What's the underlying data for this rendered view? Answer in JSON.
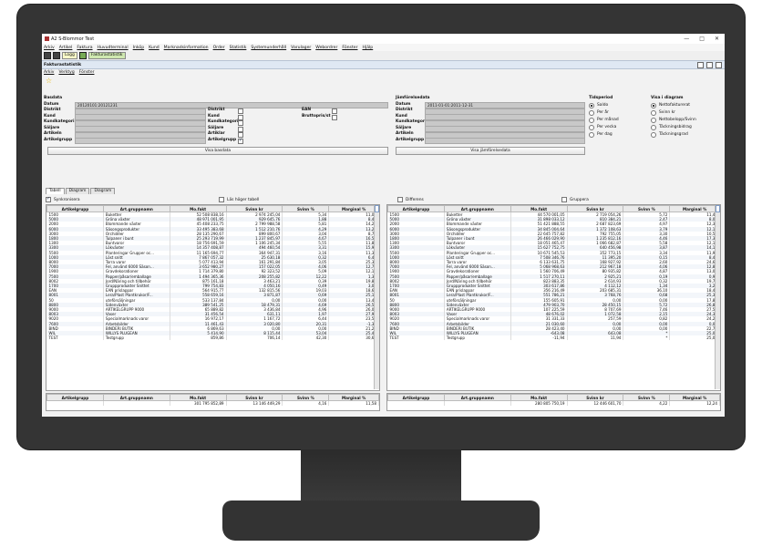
{
  "window": {
    "title": "A2 S-Blommor Test",
    "min": "—",
    "max": "□",
    "close": "✕"
  },
  "menu": [
    "Arkiv",
    "Artikel",
    "Faktura",
    "Huvudterminal",
    "Inköp",
    "Kund",
    "Marknadsinformation",
    "Order",
    "Statistik",
    "Systemunderhåll",
    "Varulager",
    "Webordrer",
    "Fönster",
    "Hjälp"
  ],
  "toolbar": {
    "logg": "Logg",
    "fakturastatistik": "Fakturastatistik"
  },
  "inner": {
    "title": "Fakturastatistik",
    "menu": [
      "Arkiv",
      "Verktyg",
      "Fönster"
    ]
  },
  "basdata": {
    "heading": "Basdata",
    "datum_label": "Datum",
    "datum": "20120101:20121231",
    "labels": [
      "Distrikt",
      "Kund",
      "Kundkategori",
      "Säljare",
      "Artikeln",
      "Artikelgrupp"
    ],
    "right_labels": [
      "Distrikt",
      "Kund",
      "Kundkategori",
      "Säljare",
      "Artiklar",
      "Artikelgrupp"
    ],
    "ean": "EAN",
    "brutto": "Bruttopris/st",
    "show": "Visa basdata"
  },
  "jamfor": {
    "heading": "Jämförelsedata",
    "datum_label": "Datum",
    "datum": "2011-01-01:2011-12-31",
    "labels": [
      "Distrikt",
      "Kund",
      "Kundkategori",
      "Säljare",
      "Artikeln",
      "Artikelgrupp"
    ],
    "show": "Visa jämförelsedata"
  },
  "tidsperiod": {
    "heading": "Tidsperiod",
    "options": [
      "Saldo",
      "Per år",
      "Per månad",
      "Per vecka",
      "Per dag"
    ],
    "selected": 0
  },
  "visa": {
    "heading": "Visa i diagram",
    "options": [
      "Nettofakturerat",
      "Svinn kr",
      "Nettobelopp/Svinn",
      "Täckningsbidrag",
      "Täckningsgrad"
    ],
    "selected": 0
  },
  "tabs": [
    "Tabell",
    "Diagram",
    "Diagram"
  ],
  "options": {
    "synkronisera": "Synkronisera",
    "las_hoger": "Läs höger tabell",
    "differens": "Differens",
    "gruppera": "Gruppera"
  },
  "columns": [
    "Artikelgrupp",
    "Art.gruppnamn",
    "Mo.fakt",
    "Svinn kr",
    "Svinn %",
    "Marginal %"
  ],
  "left_rows": [
    [
      "1500",
      "Buketter",
      "52 508 838,16",
      "2 974 245,04",
      "5,34",
      "11,03"
    ],
    [
      "5000",
      "Gröna växter",
      "48 971 001,95",
      "929 645,76",
      "1,88",
      "8,40"
    ],
    [
      "2000",
      "Blommande växter",
      "45 408 233,75",
      "2 799 988,58",
      "5,81",
      "14,23"
    ],
    [
      "6000",
      "Säsongsprodukter",
      "33 495 383,68",
      "1 512 210,76",
      "4,29",
      "13,26"
    ],
    [
      "3000",
      "Orchidéer",
      "28 135 290,67",
      "899 800,67",
      "3,04",
      "8,72"
    ],
    [
      "1800",
      "Tulpaner i bunt",
      "25 293 719,99",
      "1 237 845,97",
      "4,67",
      "16,56"
    ],
    [
      "1300",
      "Buntvaror",
      "18 756 691,59",
      "1 106 245,34",
      "5,55",
      "11,86"
    ],
    [
      "3300",
      "Lökväxter",
      "14 357 408,87",
      "494 460,54",
      "3,31",
      "15,98"
    ],
    [
      "5500",
      "Planteringar Grupper oc...",
      "11 165 694,77",
      "364 947,31",
      "3,16",
      "11,36"
    ],
    [
      "1000",
      "Löst snitt",
      "7 867 057,32",
      "25 630,18",
      "0,32",
      "6,47"
    ],
    [
      "8000",
      "Torra varor",
      "5 077 413,94",
      "161 291,84",
      "3,05",
      "25,36"
    ],
    [
      "7000",
      "Fel, använd 6000 Säson...",
      "3 652 980,27",
      "157 022,05",
      "4,06",
      "12,79"
    ],
    [
      "1900",
      "Gravdekorationer",
      "1 714 379,80",
      "92 323,52",
      "5,09",
      "12,17"
    ],
    [
      "7500",
      "Papper/påsar/emballage",
      "1 494 365,36",
      "208 255,82",
      "12,22",
      "1,30"
    ],
    [
      "8002",
      "Jord/Näring och tillbehör",
      "875 161,18",
      "3 463,21",
      "0,39",
      "19,88"
    ],
    [
      "1700",
      "Gruppprodukter Snittet",
      "799 754,83",
      "4 050,16",
      "0,49",
      "3,02"
    ],
    [
      "EAN",
      "EAN prislappar",
      "564 915,77",
      "132 815,56",
      "19,03",
      "18,66"
    ],
    [
      "8001",
      "Lera/Plast Plantkrukor/F...",
      "558 659,16",
      "3 871,87",
      "0,69",
      "25,12"
    ],
    [
      "50",
      "uteförsäljningar",
      "533 137,84",
      "0,00",
      "0,00",
      "13,41"
    ],
    [
      "8800",
      "Sidenväxter",
      "389 541,25",
      "18 479,31",
      "4,69",
      "26,57"
    ],
    [
      "9000",
      "ARTIKELGRUPP 9000",
      "65 889,82",
      "3 436,84",
      "4,96",
      "26,08"
    ],
    [
      "8003",
      "Vaser",
      "31 456,54",
      "631,11",
      "1,97",
      "27,97"
    ],
    [
      "9020",
      "Specialmarknads varor",
      "16 972,17",
      "1 167,72",
      "6,44",
      "23,54"
    ],
    [
      "7600",
      "Arbetsbilder",
      "11 461,43",
      "3 020,80",
      "20,31",
      "-1,36"
    ],
    [
      "BIND",
      "BINDERI BUTIK",
      "6 869,63",
      "0,00",
      "0,00",
      "21,23"
    ],
    [
      "WIL",
      "WILLYS PLUGEAN",
      "5 414,90",
      "8 115,44",
      "53,04",
      "25,48"
    ],
    [
      "TEST",
      "Testgrupp",
      "859,86",
      "706,14",
      "42,30",
      "30,61"
    ]
  ],
  "right_rows": [
    [
      "1500",
      "Buketter",
      "44 570 001,05",
      "2 719 054,26",
      "5,72",
      "11,42"
    ],
    [
      "5000",
      "Gröna växter",
      "31 898 033,12",
      "810 384,21",
      "2,47",
      "8,09"
    ],
    [
      "2000",
      "Blommande växter",
      "51 421 888,55",
      "2 687 823,69",
      "4,97",
      "12,31"
    ],
    [
      "6000",
      "Säsongsprodukter",
      "34 845 004,64",
      "1 372 108,63",
      "3,79",
      "12,19"
    ],
    [
      "3000",
      "Orchidéer",
      "22 645 757,82",
      "792 755,05",
      "3,30",
      "10,55"
    ],
    [
      "1800",
      "Tulpaner i bunt",
      "26 466 029,90",
      "1 235 812,16",
      "4,46",
      "17,39"
    ],
    [
      "1300",
      "Buntvaror",
      "18 051 465,47",
      "1 066 682,87",
      "5,58",
      "12,19"
    ],
    [
      "3300",
      "Lökväxter",
      "15 627 752,75",
      "640 456,98",
      "3,87",
      "14,16"
    ],
    [
      "5500",
      "Planteringar Grupper oc...",
      "10 671 545,53",
      "352 773,15",
      "3,34",
      "11,95"
    ],
    [
      "1000",
      "Löst snitt",
      "7 508 346,76",
      "11 395,20",
      "0,15",
      "8,40"
    ],
    [
      "8000",
      "Torra varor",
      "6 133 631,75",
      "168 927,92",
      "2,60",
      "24,65"
    ],
    [
      "7000",
      "Fel, använd 6000 Säson...",
      "5 068 968,63",
      "212 967,18",
      "4,06",
      "12,83"
    ],
    [
      "1900",
      "Gravdekorationer",
      "1 560 706,49",
      "80 935,82",
      "4,87",
      "13,03"
    ],
    [
      "7500",
      "Papper/påsar/emballage",
      "1 517 270,11",
      "2 925,21",
      "0,19",
      "0,92"
    ],
    [
      "8002",
      "Jord/Näring och tillbehör",
      "823 883,35",
      "2 614,93",
      "0,32",
      "19,75"
    ],
    [
      "1700",
      "Gruppprodukter Snittet",
      "303 617,86",
      "4 112,12",
      "1,34",
      "3,28"
    ],
    [
      "EAN",
      "EAN prislappar",
      "356 216,49",
      "203 685,31",
      "36,10",
      "18,48"
    ],
    [
      "8001",
      "Lera/Plast Plantkrukor/F...",
      "551 786,21",
      "3 768,76",
      "0,68",
      "25,35"
    ],
    [
      "50",
      "uteförsäljningar",
      "155 605,91",
      "0,00",
      "0,00",
      "17,81"
    ],
    [
      "8800",
      "Sidenväxter",
      "479 903,70",
      "28 450,15",
      "5,72",
      "26,81"
    ],
    [
      "9000",
      "ARTIKELGRUPP 9000",
      "107 225,59",
      "8 707,69",
      "7,46",
      "27,51"
    ],
    [
      "8003",
      "Vaser",
      "48 676,02",
      "1 072,58",
      "2,15",
      "24,32"
    ],
    [
      "9020",
      "Specialmarknads varor",
      "31 331,33",
      "257,59",
      "0,82",
      "24,23"
    ],
    [
      "7600",
      "Arbetsbilder",
      "21 030,60",
      "0,00",
      "0,00",
      "0,05"
    ],
    [
      "BIND",
      "BINDERI BUTIK",
      "28 423,40",
      "0,00",
      "0,00",
      "22,70"
    ],
    [
      "WIL",
      "WILLYS PLUGEAN",
      "-643,08",
      "643,08",
      "*",
      "25,00"
    ],
    [
      "TEST",
      "Testgrupp",
      "-11,94",
      "11,94",
      "*",
      "25,00"
    ]
  ],
  "left_sum": [
    "",
    "",
    "301 795 852,89",
    "13 146 449,29",
    "4,16",
    "11,58"
  ],
  "right_sum": [
    "",
    "",
    "280 805 750,19",
    "12 446 601,70",
    "4,22",
    "12,24"
  ]
}
